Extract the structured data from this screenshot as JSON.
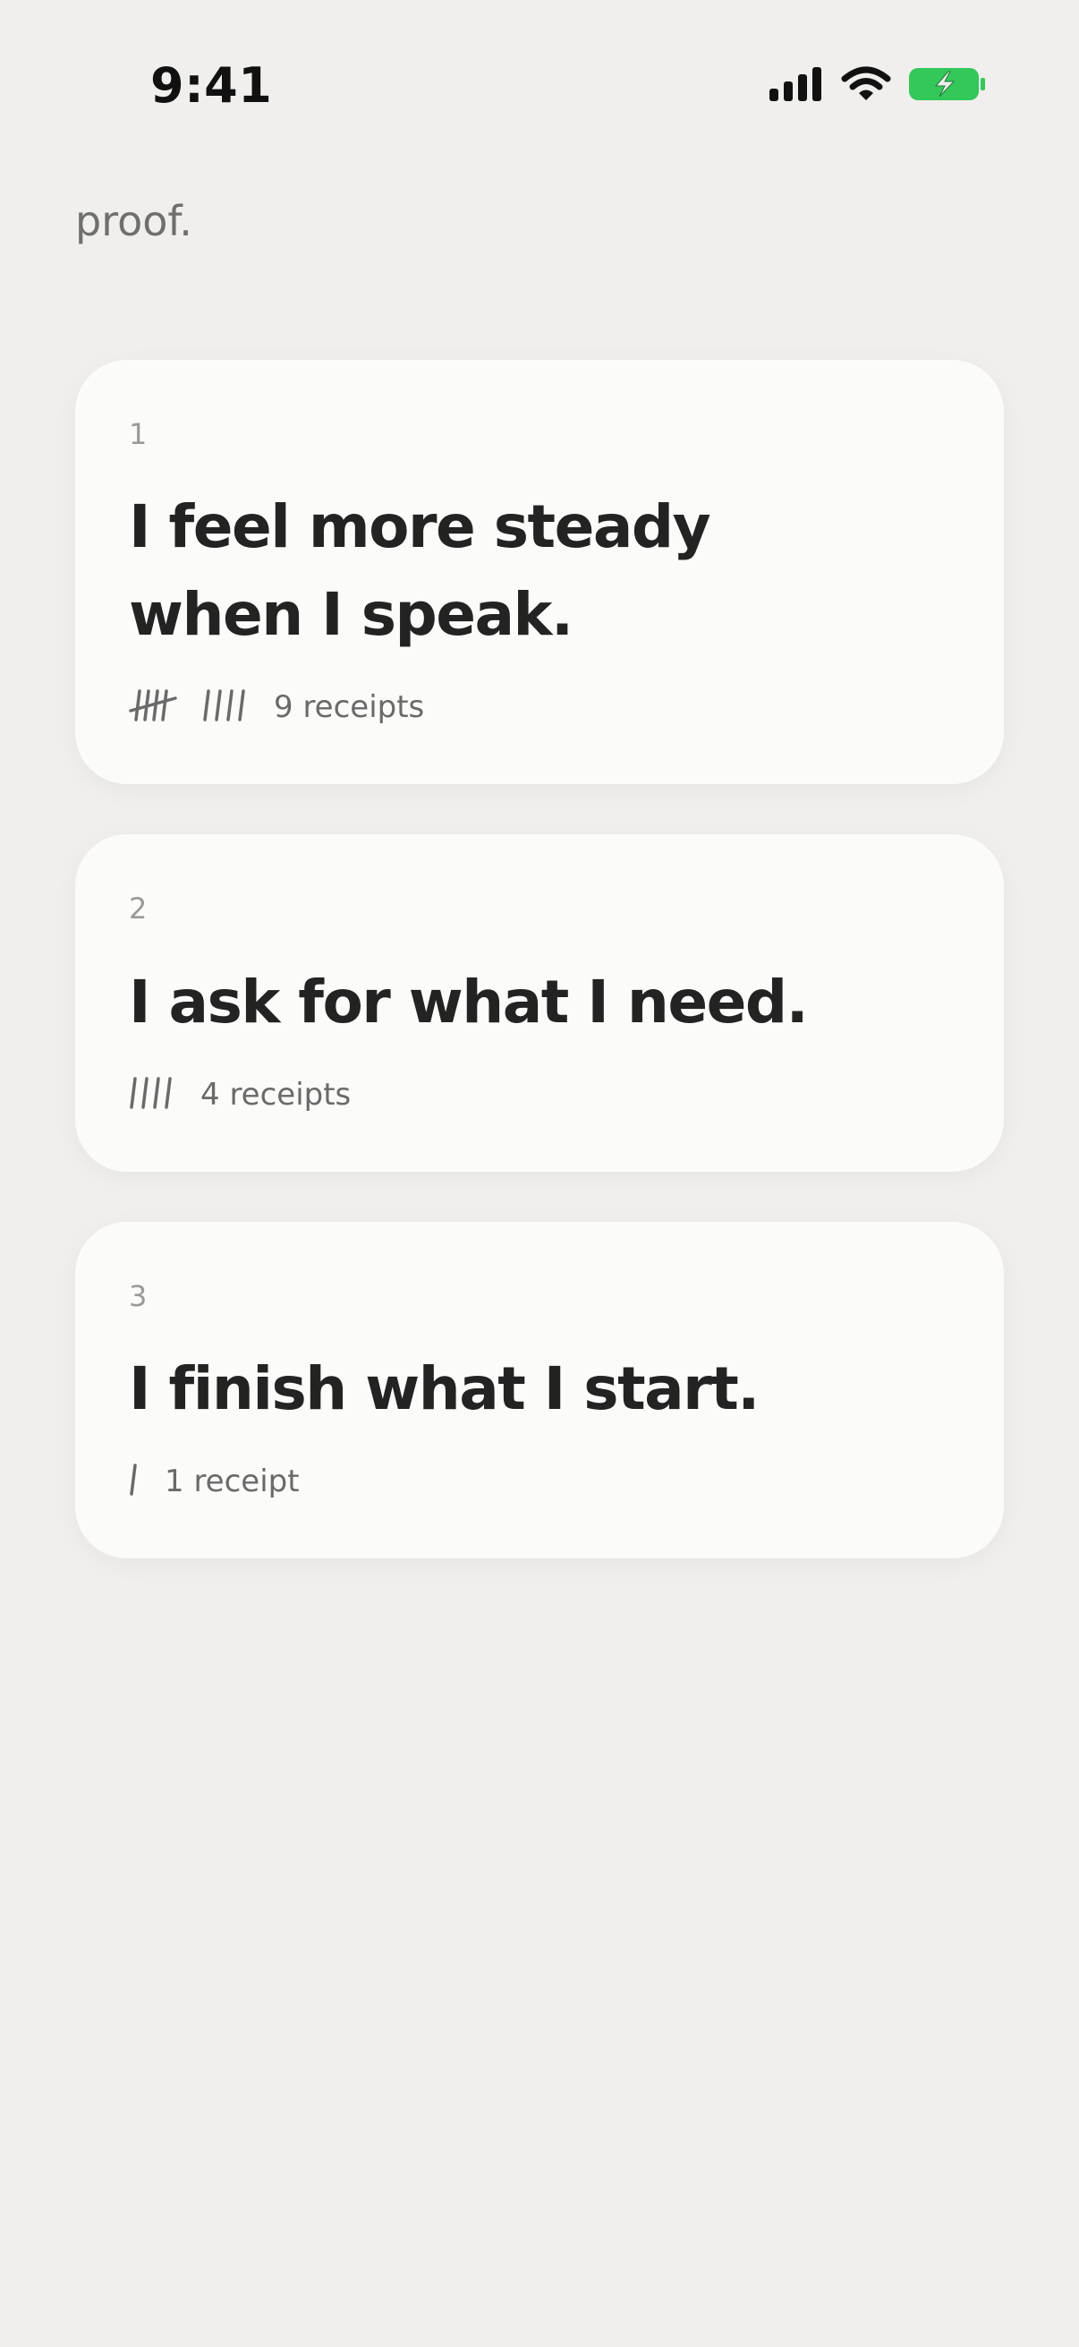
{
  "status_bar": {
    "time": "9:41",
    "icons": [
      "cellular-signal-icon",
      "wifi-icon",
      "battery-charging-icon"
    ],
    "battery_color": "#34c759"
  },
  "app": {
    "title": "proof."
  },
  "cards": [
    {
      "index": "1",
      "title": "I feel more steady when I speak.",
      "receipt_count": 9,
      "receipt_label": "9 receipts"
    },
    {
      "index": "2",
      "title": "I ask for what I need.",
      "receipt_count": 4,
      "receipt_label": "4 receipts"
    },
    {
      "index": "3",
      "title": "I finish what I start.",
      "receipt_count": 1,
      "receipt_label": "1 receipt"
    }
  ],
  "colors": {
    "background": "#f0efed",
    "card": "#fbfbf9",
    "text_primary": "#232323",
    "text_secondary": "#6a6a6a",
    "tally": "#6a6a6a"
  }
}
